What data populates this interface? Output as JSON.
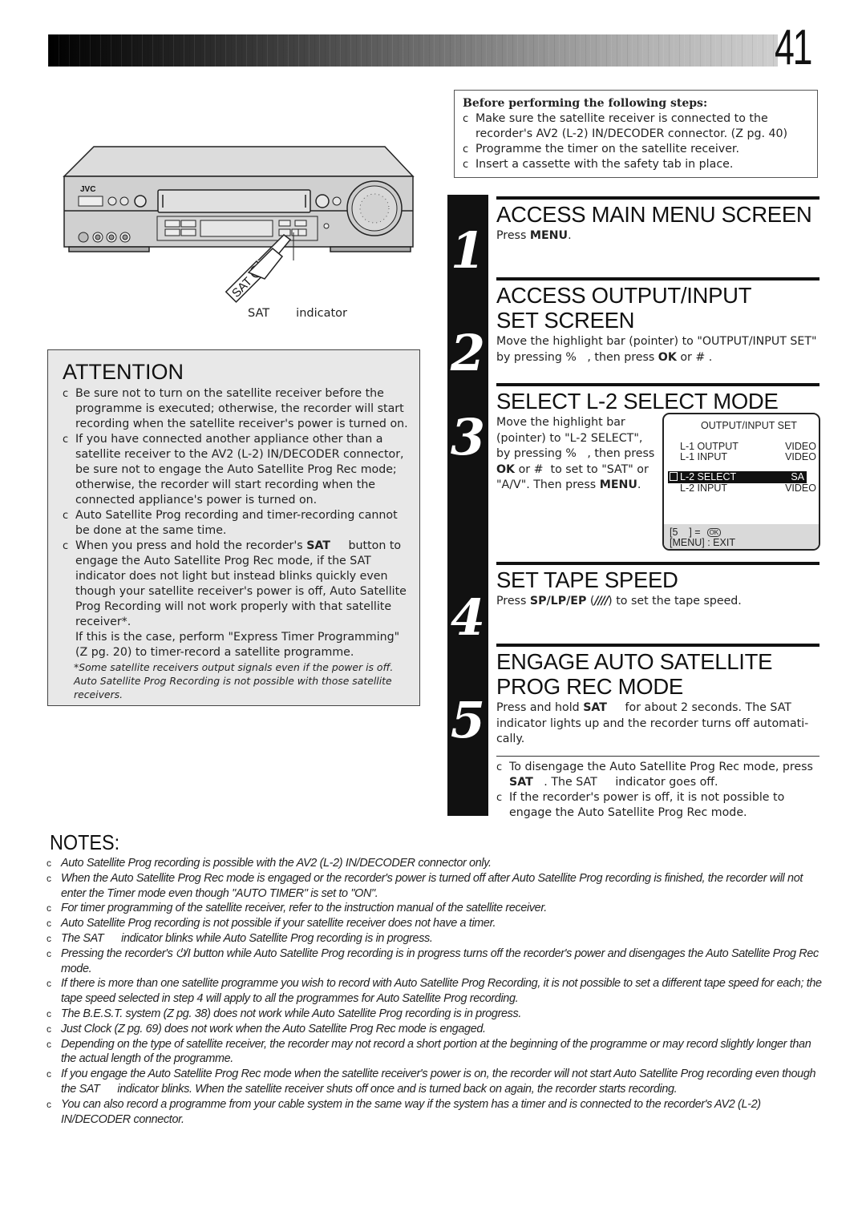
{
  "page": {
    "number": "41"
  },
  "before_steps": {
    "title": "Before performing the following steps:",
    "bullet_glyph": "c",
    "items": [
      "Make sure the satellite receiver is connected to the recorder's AV2 (L-2) IN/DECODER connector. (Z  pg. 40)",
      "Programme the timer on the satellite receiver.",
      "Insert a cassette with the safety tab in place."
    ]
  },
  "illustration": {
    "brand": "JVC",
    "sat_button_label": "SAT",
    "caption_sat": "SAT",
    "caption_indicator": "indicator"
  },
  "attention": {
    "title": "ATTENTION",
    "items": [
      "Be sure not to turn on the satellite receiver before the programme is executed; otherwise, the recorder will start recording when the satellite receiver's power is turned on.",
      "If you have connected another appliance other than a satellite receiver to the AV2 (L-2) IN/DECODER connector, be sure not to engage the Auto Satellite Prog Rec mode; otherwise, the recorder will start recording when the connected appliance's power is turned on.",
      "Auto Satellite Prog recording and timer-recording cannot be done at the same time."
    ],
    "item4_pre": "When you press and hold the recorder's ",
    "item4_bold": "SAT",
    "item4_post": "     button to engage the Auto Satellite Prog Rec mode, if the SAT indicator does not light but instead blinks quickly even though your satellite receiver's power is off, Auto Satellite Prog Recording will not work properly with that satellite receiver*.",
    "item4_cont": "If this is the case, perform \"Express Timer Programming\" (Z  pg. 20) to timer-record a satellite programme.",
    "footnote_mark": "*",
    "footnote": "Some satellite receivers output signals even if the power is off. Auto Satellite Prog Recording is not possible with those satellite receivers."
  },
  "steps": [
    {
      "number": "1",
      "title": "ACCESS MAIN MENU SCREEN",
      "text_pre": "Press ",
      "text_bold": "MENU",
      "text_post": "."
    },
    {
      "number": "2",
      "title": "ACCESS OUTPUT/INPUT SET SCREEN",
      "text_pre": "Move the highlight bar (pointer) to \"OUTPUT/INPUT SET\" by pressing %   , then press ",
      "text_bold": "OK",
      "text_post": " or # ."
    },
    {
      "number": "3",
      "title": "SELECT L-2 SELECT MODE",
      "text_a": "Move the highlight bar (pointer) to \"L-2 SELECT\", by pressing %   , then press ",
      "text_bold1": "OK",
      "text_b": " or #  to set to \"SAT\" or \"A/V\". Then press ",
      "text_bold2": "MENU",
      "text_c": "."
    },
    {
      "number": "4",
      "title": "SET TAPE SPEED",
      "text_pre": "Press ",
      "text_bold": "SP/LP/EP",
      "text_mid": " (",
      "text_icon": "////",
      "text_post": ") to set the tape speed."
    },
    {
      "number": "5",
      "title": "ENGAGE AUTO SATELLITE PROG REC MODE",
      "text_pre": "Press and hold ",
      "text_bold": "SAT",
      "text_post": "     for about 2 seconds. The SAT     indicator lights up and the recorder turns off automati-cally.",
      "sub_items": [
        {
          "bold": "",
          "pre": "To disengage the Auto Satellite Prog Rec mode, press ",
          "b": "SAT",
          "post": "   . The SAT     indicator goes off."
        },
        {
          "pre": "If the recorder's power is off, it is not possible to engage the Auto Satellite Prog Rec mode.",
          "b": "",
          "post": ""
        }
      ]
    }
  ],
  "osd": {
    "title": "OUTPUT/INPUT SET",
    "rows": [
      {
        "label": "L-1 OUTPUT",
        "value": "VIDEO"
      },
      {
        "label": "L-1 INPUT",
        "value": "VIDEO"
      },
      {
        "label": "L-2 SELECT",
        "value": "SA",
        "highlighted": true
      },
      {
        "label": "L-2 INPUT",
        "value": "VIDEO"
      }
    ],
    "footer_line1": "[5    ] =",
    "ok_badge": "OK",
    "footer_line2": "[MENU] : EXIT"
  },
  "notes": {
    "title": "NOTES:",
    "items": [
      "Auto Satellite Prog recording is possible with the AV2 (L-2) IN/DECODER connector only.",
      "When the Auto Satellite Prog Rec mode is engaged or the recorder's power is turned off after Auto Satellite Prog recording is finished, the recorder will not enter the Timer mode even though \"AUTO TIMER\" is set to \"ON\".",
      "For timer programming of the satellite receiver, refer to the instruction manual of the satellite receiver.",
      "Auto Satellite Prog recording is not possible if your satellite receiver does not have a timer.",
      "The SAT      indicator blinks while Auto Satellite Prog recording is in progress.",
      "Pressing the recorder's ⏻/I button while Auto Satellite Prog recording is in progress turns off the recorder's power and disengages the Auto Satellite Prog Rec mode.",
      "If there is more than one satellite programme you wish to record with Auto Satellite Prog Recording, it is not possible to set a different tape speed for each; the tape speed selected in step 4 will apply to all the programmes for Auto Satellite Prog recording.",
      "The B.E.S.T. system (Z  pg. 38) does not work while Auto Satellite Prog recording is in progress.",
      "Just Clock (Z  pg. 69) does not work when the Auto Satellite Prog Rec mode is engaged.",
      "Depending on the type of satellite receiver, the recorder may not record a short portion at the beginning of the programme or may record slightly longer than the actual length of the programme.",
      "If you engage the Auto Satellite Prog Rec mode when the satellite receiver's power is on, the recorder will not start Auto Satellite Prog recording even though the SAT      indicator blinks. When the satellite receiver shuts off once and is turned back on again, the recorder starts recording.",
      "You can also record a programme from your cable system in the same way if the system has a timer and is connected to the recorder's AV2 (L-2) IN/DECODER connector."
    ]
  }
}
